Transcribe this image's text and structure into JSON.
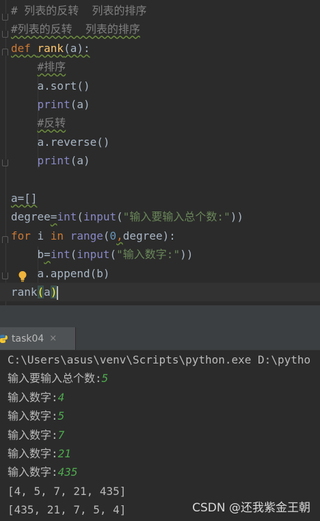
{
  "editor": {
    "lines": [
      {
        "parts": [
          {
            "t": "# 列表的反转  列表的排序",
            "c": "c-comment"
          }
        ]
      },
      {
        "parts": [
          {
            "t": "#列表的反转  列表的排序",
            "c": "c-comment-u"
          }
        ]
      },
      {
        "parts": [
          {
            "t": "def ",
            "c": "c-kw c-under"
          },
          {
            "t": "rank",
            "c": "c-fn c-under"
          },
          {
            "t": "(a):",
            "c": "c-plain c-under"
          }
        ]
      },
      {
        "parts": [
          {
            "t": "    "
          },
          {
            "t": "#排序",
            "c": "c-comment-u"
          }
        ]
      },
      {
        "parts": [
          {
            "t": "    a.sort()",
            "c": "c-plain"
          }
        ]
      },
      {
        "parts": [
          {
            "t": "    "
          },
          {
            "t": "print",
            "c": "c-builtin"
          },
          {
            "t": "(a)",
            "c": "c-plain"
          }
        ]
      },
      {
        "parts": [
          {
            "t": "    "
          },
          {
            "t": "#反转",
            "c": "c-comment-u"
          }
        ]
      },
      {
        "parts": [
          {
            "t": "    a.reverse()",
            "c": "c-plain"
          }
        ]
      },
      {
        "parts": [
          {
            "t": "    "
          },
          {
            "t": "print",
            "c": "c-builtin"
          },
          {
            "t": "(a)",
            "c": "c-plain"
          }
        ]
      },
      {
        "parts": [
          {
            "t": ""
          }
        ]
      },
      {
        "parts": [
          {
            "t": "a=[]",
            "c": "c-plain c-under"
          }
        ]
      },
      {
        "parts": [
          {
            "t": "degree",
            "c": "c-plain"
          },
          {
            "t": "=",
            "c": "c-plain c-under"
          },
          {
            "t": "int",
            "c": "c-builtin"
          },
          {
            "t": "(",
            "c": "c-plain"
          },
          {
            "t": "input",
            "c": "c-builtin"
          },
          {
            "t": "(",
            "c": "c-plain"
          },
          {
            "t": "\"输入要输入总个数:\"",
            "c": "c-str"
          },
          {
            "t": "))",
            "c": "c-plain"
          }
        ]
      },
      {
        "parts": [
          {
            "t": "for ",
            "c": "c-kw"
          },
          {
            "t": "i ",
            "c": "c-plain"
          },
          {
            "t": "in ",
            "c": "c-kw"
          },
          {
            "t": "range",
            "c": "c-builtin"
          },
          {
            "t": "(",
            "c": "c-plain"
          },
          {
            "t": "0",
            "c": "c-num"
          },
          {
            "t": ",",
            "c": "c-kw c-under"
          },
          {
            "t": "degree):",
            "c": "c-plain"
          }
        ]
      },
      {
        "parts": [
          {
            "t": "    b",
            "c": "c-plain"
          },
          {
            "t": "=",
            "c": "c-plain c-under"
          },
          {
            "t": "int",
            "c": "c-builtin"
          },
          {
            "t": "(",
            "c": "c-plain"
          },
          {
            "t": "input",
            "c": "c-builtin"
          },
          {
            "t": "(",
            "c": "c-plain"
          },
          {
            "t": "\"输入数字:\"",
            "c": "c-str"
          },
          {
            "t": "))",
            "c": "c-plain"
          }
        ]
      },
      {
        "parts": [
          {
            "t": "    a.append(b)",
            "c": "c-plain"
          }
        ]
      },
      {
        "parts": [
          {
            "t": "rank",
            "c": "c-plain"
          },
          {
            "t": "(",
            "c": "c-paren-hl"
          },
          {
            "t": "a",
            "c": "c-plain"
          },
          {
            "t": ")",
            "c": "c-paren-hl"
          }
        ]
      }
    ]
  },
  "run_panel": {
    "tab_label": "task04",
    "close_glyph": "×"
  },
  "console": {
    "lines": [
      {
        "text": "C:\\Users\\asus\\venv\\Scripts\\python.exe D:\\pytho",
        "input": ""
      },
      {
        "text": "输入要输入总个数:",
        "input": "5"
      },
      {
        "text": "输入数字:",
        "input": "4"
      },
      {
        "text": "输入数字:",
        "input": "5"
      },
      {
        "text": "输入数字:",
        "input": "7"
      },
      {
        "text": "输入数字:",
        "input": "21"
      },
      {
        "text": "输入数字:",
        "input": "435"
      },
      {
        "text": "[4, 5, 7, 21, 435]",
        "input": ""
      },
      {
        "text": "[435, 21, 7, 5, 4]",
        "input": ""
      }
    ]
  },
  "watermark": "CSDN @还我紫金王朝"
}
